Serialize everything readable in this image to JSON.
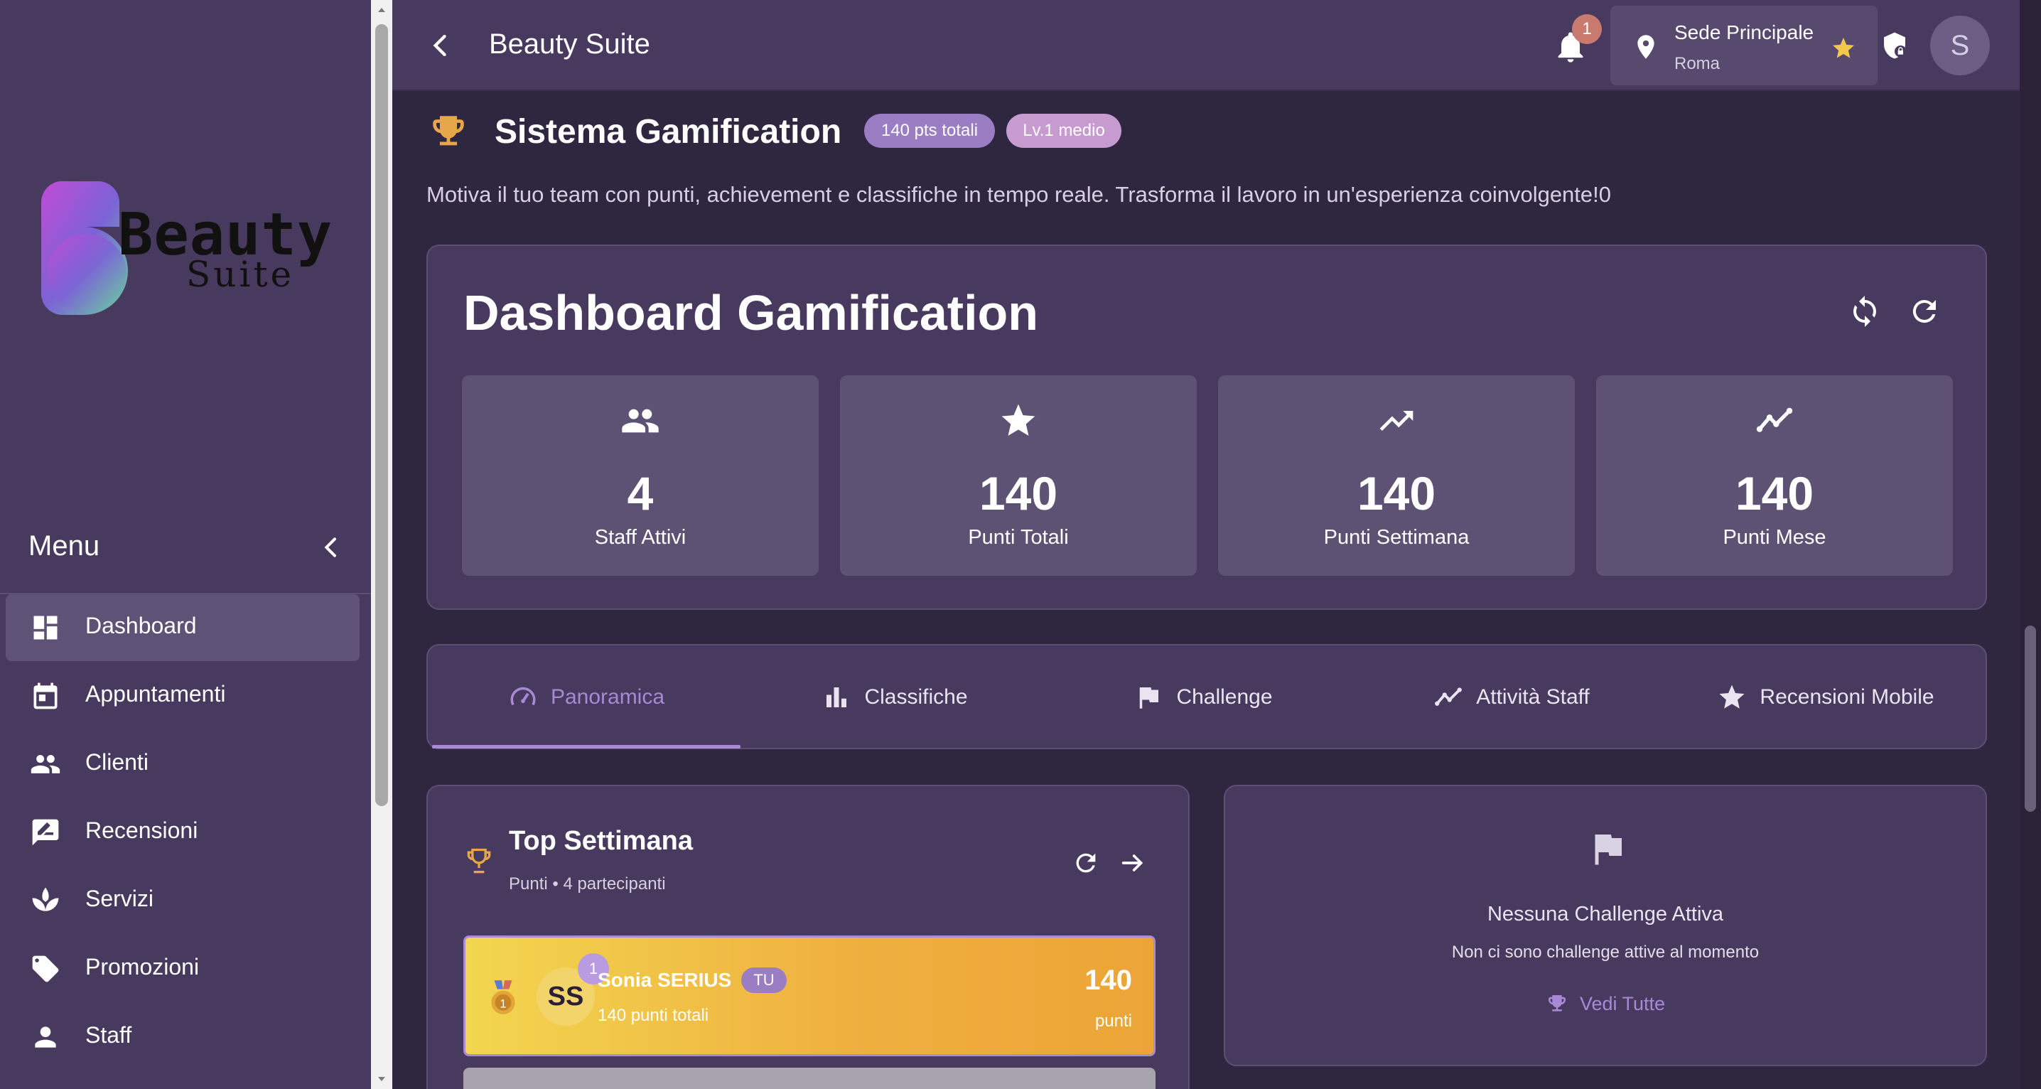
{
  "sidebar": {
    "logo_line1": "Beauty",
    "logo_line2": "Suite",
    "menu_title": "Menu",
    "items": [
      {
        "label": "Dashboard",
        "icon": "dashboard-icon",
        "active": true
      },
      {
        "label": "Appuntamenti",
        "icon": "calendar-icon"
      },
      {
        "label": "Clienti",
        "icon": "people-icon"
      },
      {
        "label": "Recensioni",
        "icon": "rate-review-icon"
      },
      {
        "label": "Servizi",
        "icon": "spa-icon"
      },
      {
        "label": "Promozioni",
        "icon": "tag-icon"
      },
      {
        "label": "Staff",
        "icon": "person-icon"
      }
    ]
  },
  "header": {
    "title": "Beauty Suite",
    "notification_count": "1",
    "location_name": "Sede Principale",
    "location_city": "Roma",
    "avatar_initial": "S"
  },
  "gamification": {
    "title": "Sistema Gamification",
    "points_pill": "140 pts totali",
    "level_pill": "Lv.1 medio",
    "description": "Motiva il tuo team con punti, achievement e classifiche in tempo reale. Trasforma il lavoro in un'esperienza coinvolgente!0"
  },
  "dashboard": {
    "title": "Dashboard Gamification",
    "stats": [
      {
        "value": "4",
        "label": "Staff Attivi",
        "icon": "group-icon"
      },
      {
        "value": "140",
        "label": "Punti Totali",
        "icon": "star-icon"
      },
      {
        "value": "140",
        "label": "Punti Settimana",
        "icon": "trending-up-icon"
      },
      {
        "value": "140",
        "label": "Punti Mese",
        "icon": "show-chart-icon"
      }
    ]
  },
  "tabs": [
    {
      "label": "Panoramica",
      "icon": "speed-icon",
      "active": true
    },
    {
      "label": "Classifiche",
      "icon": "bar-chart-icon"
    },
    {
      "label": "Challenge",
      "icon": "flag-icon"
    },
    {
      "label": "Attività Staff",
      "icon": "timeline-icon"
    },
    {
      "label": "Recensioni Mobile",
      "icon": "star-icon"
    }
  ],
  "top_week": {
    "title": "Top Settimana",
    "subtitle": "Punti • 4 partecipanti",
    "rows": [
      {
        "rank": "1",
        "initials": "SS",
        "name": "Sonia SERIUS",
        "badge": "TU",
        "sub": "140 punti totali",
        "points": "140",
        "points_label": "punti"
      }
    ]
  },
  "challenges": {
    "title": "Nessuna Challenge Attiva",
    "subtitle": "Non ci sono challenge attive al momento",
    "link": "Vedi Tutte"
  },
  "colors": {
    "sidebar_bg": "#473a5e",
    "page_bg": "#2f2640",
    "accent": "#a889d6",
    "gold": "#f2c14e"
  }
}
